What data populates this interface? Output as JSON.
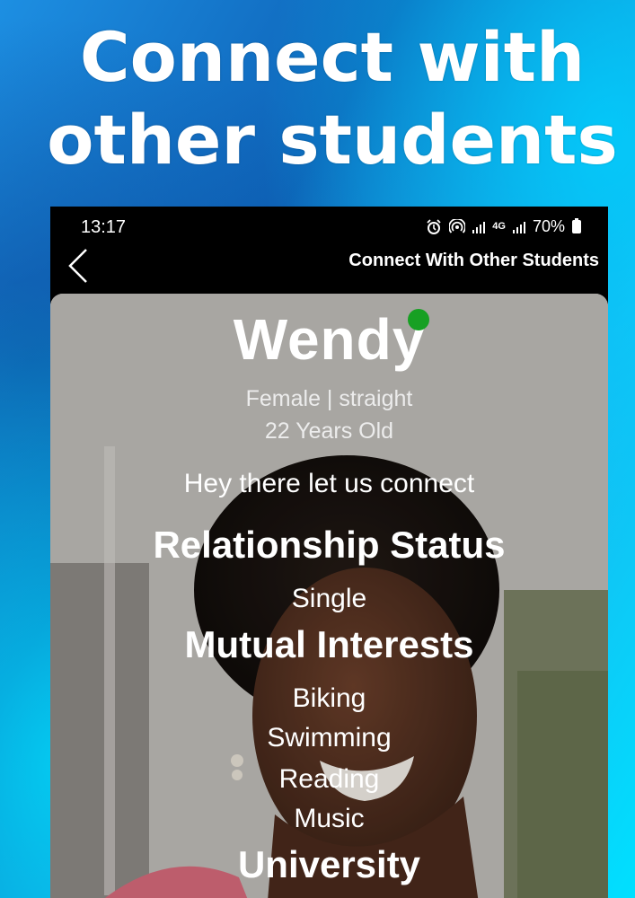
{
  "promo": {
    "headline_line1": "Connect with",
    "headline_line2": "other students"
  },
  "status_bar": {
    "time": "13:17",
    "network": "4G",
    "battery": "70%"
  },
  "header": {
    "title": "Connect With Other Students",
    "back_icon": "chevron-left-icon"
  },
  "profile": {
    "name": "Wendy",
    "online": true,
    "gender_orientation": "Female | straight",
    "age": "22 Years Old",
    "bio": "Hey there let us connect",
    "relationship_heading": "Relationship Status",
    "relationship_value": "Single",
    "interests_heading": "Mutual Interests",
    "interests": [
      "Biking",
      "Swimming",
      "Reading",
      "Music"
    ],
    "university_heading": "University"
  },
  "colors": {
    "online": "#17a023",
    "background": "#1d8fe2",
    "accent": "#00e0ff"
  }
}
